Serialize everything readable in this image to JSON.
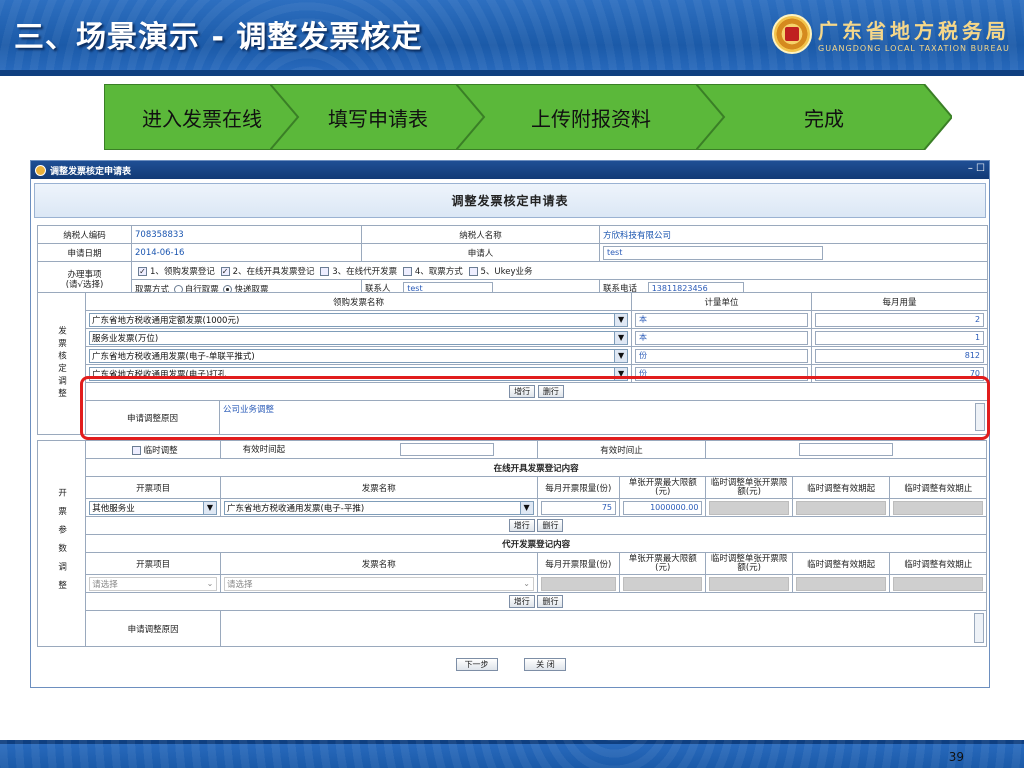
{
  "slide": {
    "title": "三、场景演示 - 调整发票核定",
    "logo_cn": "广东省地方税务局",
    "logo_en": "GUANGDONG LOCAL TAXATION BUREAU",
    "page_number": "39"
  },
  "steps": [
    "进入发票在线",
    "填写申请表",
    "上传附报资料",
    "完成"
  ],
  "window": {
    "title": "调整发票核定申请表",
    "form_title": "调整发票核定申请表",
    "controls": "– ☐"
  },
  "taxpayer": {
    "id_label": "纳税人编码",
    "id_value": "708358833",
    "name_label": "纳税人名称",
    "name_value": "方欣科技有限公司",
    "date_label": "申请日期",
    "date_value": "2014-06-16",
    "applicant_label": "申请人",
    "applicant_value": "test"
  },
  "matters": {
    "label_line1": "办理事项",
    "label_line2": "(请√选择)",
    "options": [
      "1、领购发票登记",
      "2、在线开具发票登记",
      "3、在线代开发票",
      "4、取票方式",
      "5、Ukey业务"
    ],
    "pickup_label": "取票方式",
    "pickup_self": "自行取票",
    "pickup_express": "快递取票",
    "contact_label": "联系人",
    "contact_value": "test",
    "phone_label": "联系电话",
    "phone_value": "13811823456"
  },
  "adjust_section": {
    "side_label": "发票核定调整",
    "col_name": "领购发票名称",
    "col_unit": "计量单位",
    "col_monthly": "每月用量",
    "rows": [
      {
        "name": "广东省地方税收通用定额发票(1000元)",
        "unit": "本",
        "monthly": "2"
      },
      {
        "name": "服务业发票(万位)",
        "unit": "本",
        "monthly": "1"
      },
      {
        "name": "广东省地方税收通用发票(电子-单联平推式)",
        "unit": "份",
        "monthly": "812"
      },
      {
        "name": "广东省地方税收通用发票(电子)打孔",
        "unit": "份",
        "monthly": "70"
      }
    ],
    "add_row": "增行",
    "del_row": "删行",
    "reason_label": "申请调整原因",
    "reason_value": "公司业务调整"
  },
  "billing_section": {
    "side_label": "开票参数调整",
    "temp_adjust": "临时调整",
    "valid_from": "有效时间起",
    "valid_to": "有效时间止",
    "online_title": "在线开具发票登记内容",
    "proxy_title": "代开发票登记内容",
    "headers": [
      "开票项目",
      "发票名称",
      "每月开票限量(份)",
      "单张开票最大限额(元)",
      "临时调整单张开票限额(元)",
      "临时调整有效期起",
      "临时调整有效期止"
    ],
    "online_row": {
      "item": "其他服务业",
      "invoice": "广东省地方税收通用发票(电子-平推)",
      "monthly": "75",
      "max": "1000000.00"
    },
    "proxy_row": {
      "item": "请选择",
      "invoice": "请选择"
    },
    "add_row": "增行",
    "del_row": "删行",
    "reason_label": "申请调整原因"
  },
  "buttons": {
    "next": "下一步",
    "close": "关 闭"
  }
}
